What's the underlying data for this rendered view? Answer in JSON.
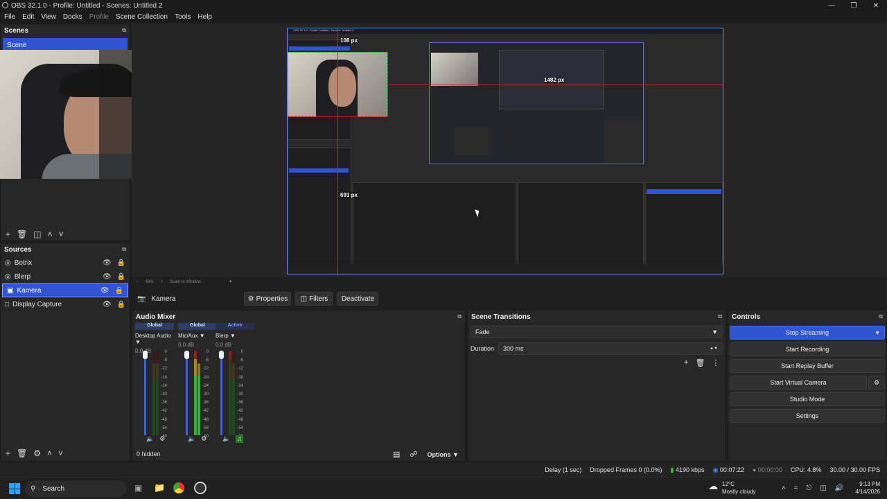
{
  "window": {
    "title": "OBS 32.1.0 - Profile: Untitled - Scenes: Untitled 2"
  },
  "menu": [
    "File",
    "Edit",
    "View",
    "Docks",
    "Profile",
    "Scene Collection",
    "Tools",
    "Help"
  ],
  "scenes": {
    "title": "Scenes",
    "items": [
      "Scene"
    ]
  },
  "sources": {
    "title": "Sources",
    "items": [
      "Botrix",
      "Blerp",
      "Kamera",
      "Display Capture"
    ],
    "selected": "Kamera"
  },
  "preview": {
    "nested_title": "OBS 32.1.0 - Profile: Untitled - Scenes: Untitled 2",
    "label_top": "108 px",
    "label_left": "693 px",
    "label_right": "1482 px",
    "zoom": "49%",
    "scale_mode": "Scale to Window"
  },
  "context": {
    "source_name": "Kamera",
    "properties": "Properties",
    "filters": "Filters",
    "deactivate": "Deactivate"
  },
  "mixer": {
    "title": "Audio Mixer",
    "channels": [
      {
        "header": "Global",
        "name": "Desktop Audio",
        "db": "0.0 dB"
      },
      {
        "header": "Global",
        "name": "Mic/Aux",
        "db": "0.0 dB"
      },
      {
        "header": "Active",
        "name": "Blerp",
        "db": "0.0 dB"
      }
    ],
    "scale": [
      "0",
      "-6",
      "-12",
      "-18",
      "-24",
      "-30",
      "-36",
      "-42",
      "-48",
      "-54",
      "-60"
    ],
    "hidden": "0 hidden",
    "options": "Options"
  },
  "transitions": {
    "title": "Scene Transitions",
    "selected": "Fade",
    "duration_label": "Duration",
    "duration_value": "300 ms"
  },
  "controls": {
    "title": "Controls",
    "buttons": [
      "Stop Streaming",
      "Start Recording",
      "Start Replay Buffer",
      "Start Virtual Camera",
      "Studio Mode",
      "Settings"
    ],
    "accent": "#2f55d4"
  },
  "status": {
    "delay": "Delay (1 sec)",
    "dropped": "Dropped Frames 0 (0.0%)",
    "bitrate": "4190 kbps",
    "stream_time": "00:07:22",
    "rec_time": "00:00:00",
    "cpu": "CPU: 4.8%",
    "fps": "30.00 / 30.00 FPS"
  },
  "taskbar": {
    "search": "Search",
    "weather_temp": "12°C",
    "weather_desc": "Mostly cloudy",
    "time": "9:13 PM",
    "date": "4/14/2026"
  }
}
